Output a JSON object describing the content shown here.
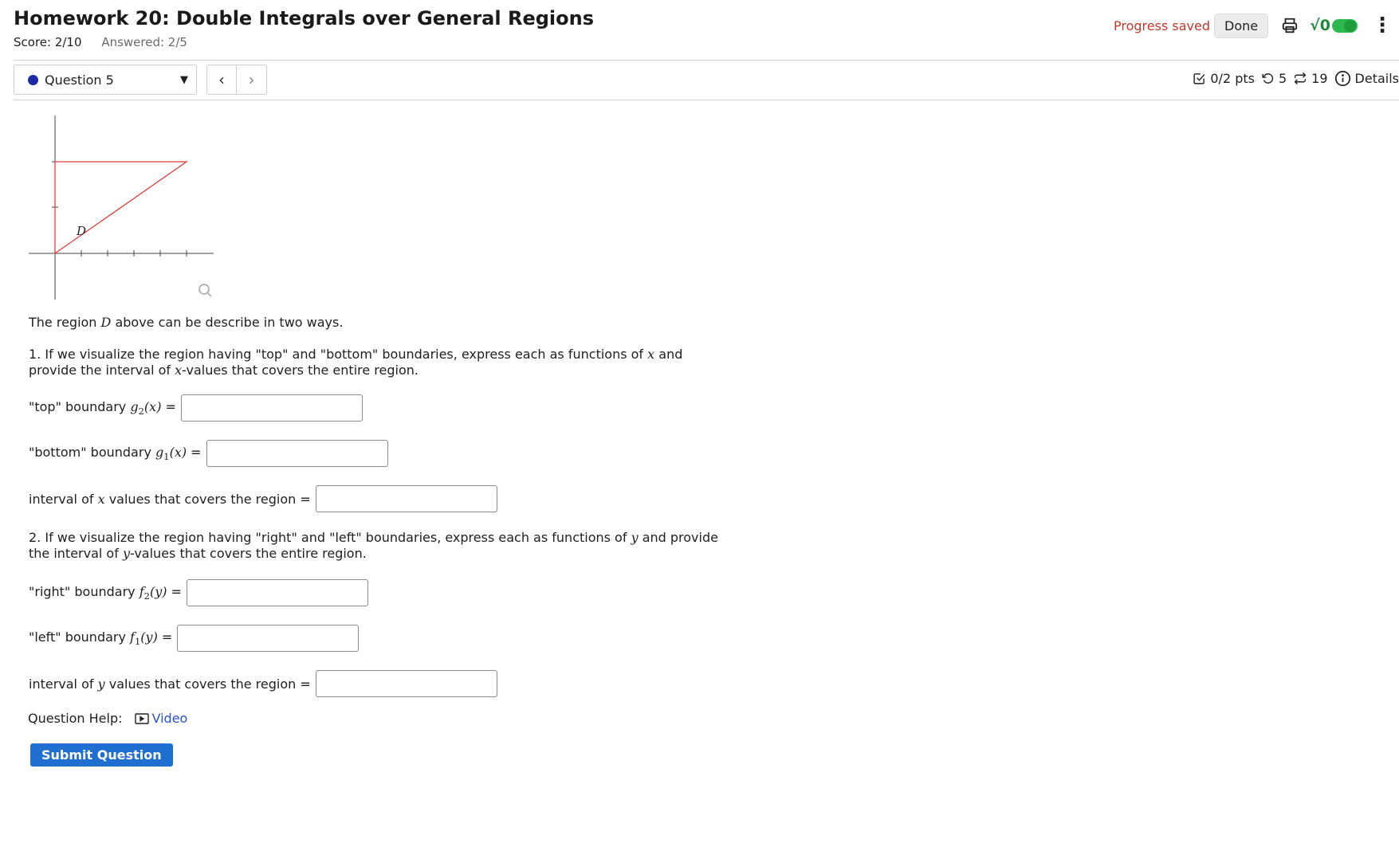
{
  "header": {
    "title": "Homework 20: Double Integrals over General Regions",
    "score": "Score: 2/10",
    "answered": "Answered: 2/5"
  },
  "top_right": {
    "progress_text": "Progress saved",
    "done_label": "Done",
    "sqrt_label": "√0",
    "toggle_on": true,
    "icons": [
      "printer-icon",
      "sqrt-toggle",
      "kebab-menu-icon"
    ]
  },
  "nav": {
    "question_label": "Question 5",
    "prev": "‹",
    "next": "›"
  },
  "meta": {
    "points": "0/2 pts",
    "retries": "5",
    "versions": "19",
    "details": "Details"
  },
  "graph": {
    "region_label": "D"
  },
  "question": {
    "intro_pre": "The region ",
    "intro_var": "D",
    "intro_post": " above can be describe in two ways.",
    "p1_line1_pre": "1. If we visualize the region having \"top\" and \"bottom\" boundaries, express each as functions of ",
    "p1_line1_var": "x",
    "p1_line1_post": " and",
    "p1_line2_pre": "provide the interval of ",
    "p1_line2_var": "x",
    "p1_line2_post": "-values that covers the entire region.",
    "top_label": "\"top\" boundary ",
    "top_fn": "g",
    "top_sub": "2",
    "top_arg": "(x)",
    "bottom_label": "\"bottom\" boundary ",
    "bottom_fn": "g",
    "bottom_sub": "1",
    "bottom_arg": "(x)",
    "xint_pre": "interval of ",
    "xint_var": "x",
    "xint_post": " values that covers the region =",
    "p2_line1_pre": "2. If we visualize the region having \"right\" and \"left\" boundaries, express each as functions of ",
    "p2_line1_var": "y",
    "p2_line1_post": " and provide",
    "p2_line2_pre": "the interval of ",
    "p2_line2_var": "y",
    "p2_line2_post": "-values that covers the entire region.",
    "right_label": "\"right\" boundary ",
    "right_fn": "f",
    "right_sub": "2",
    "right_arg": "(y)",
    "left_label": "\"left\" boundary ",
    "left_fn": "f",
    "left_sub": "1",
    "left_arg": "(y)",
    "yint_pre": "interval of ",
    "yint_var": "y",
    "yint_post": " values that covers the region =",
    "equals": " ="
  },
  "inputs": {
    "top_boundary": "",
    "bottom_boundary": "",
    "x_interval": "",
    "right_boundary": "",
    "left_boundary": "",
    "y_interval": ""
  },
  "help": {
    "label": "Question Help:",
    "video_label": "Video"
  },
  "submit_label": "Submit Question",
  "colors": {
    "region_outline": "#e03c3c",
    "progress_saved": "#c0392b",
    "submit_bg": "#1f6fd1",
    "toggle": "#2db84d",
    "link": "#2a55c8"
  }
}
